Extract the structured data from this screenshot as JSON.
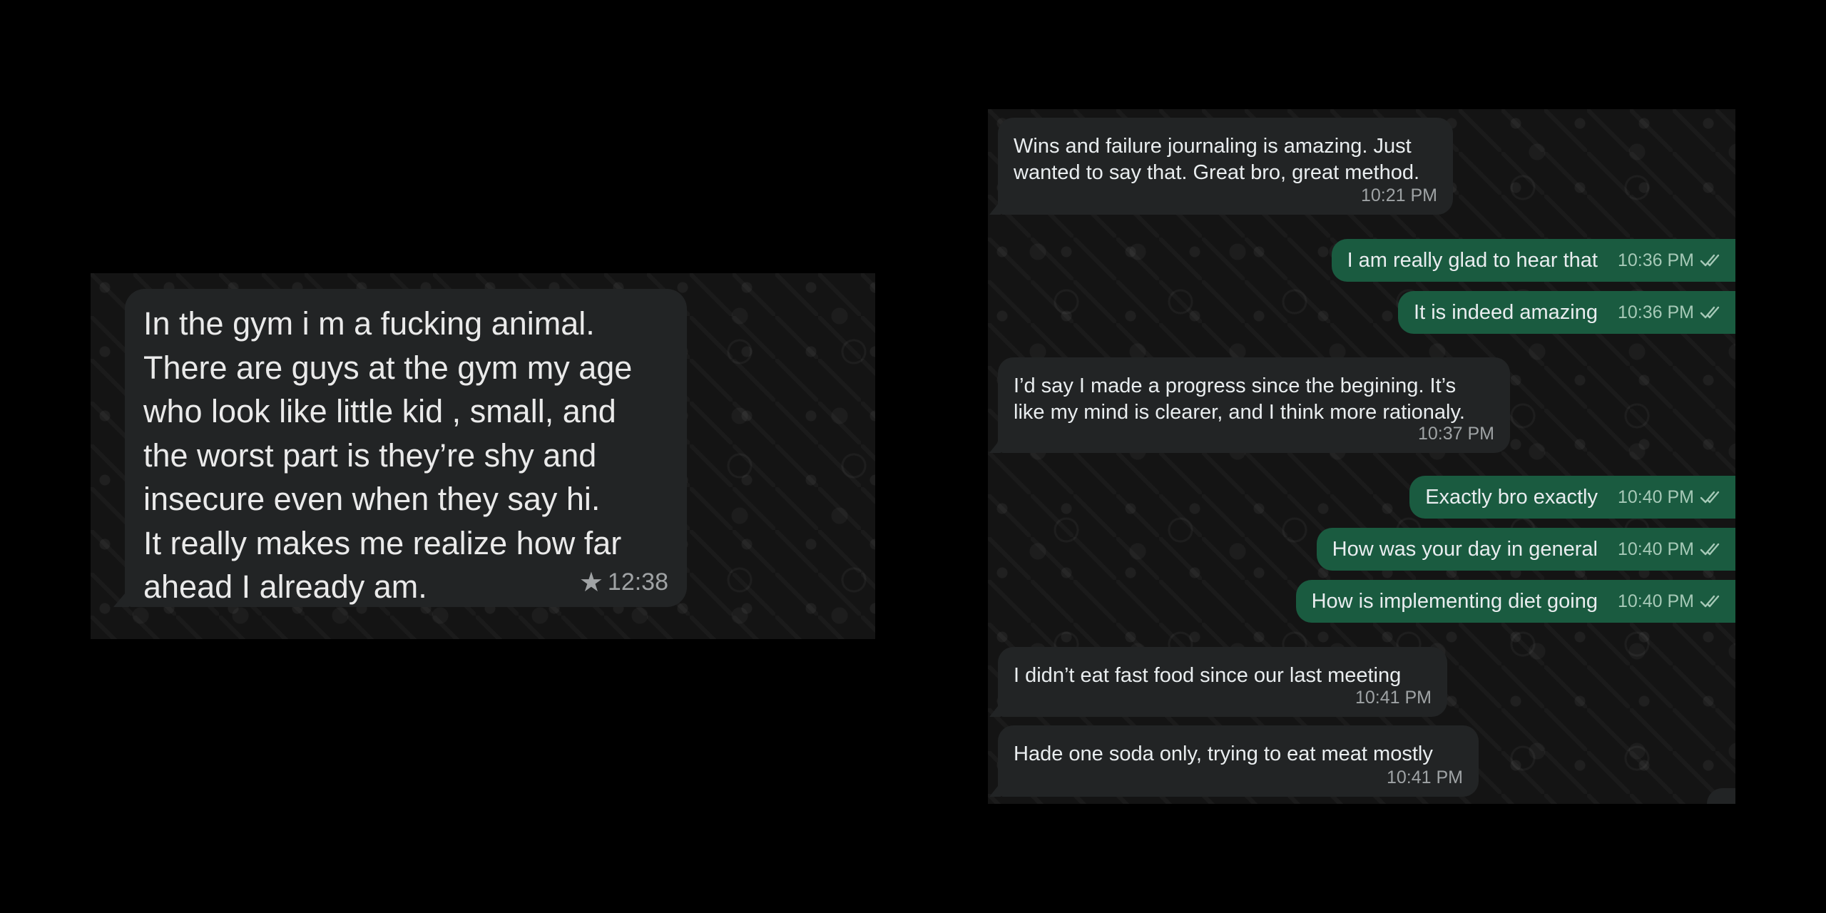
{
  "left_screenshot": {
    "message": {
      "lines": [
        "In the gym i m a fucking animal.",
        "There are guys at the gym my age",
        "who look like little kid , small, and",
        "the worst part is they’re shy and",
        "insecure even when they say hi.",
        "It really makes me realize how far",
        "ahead I already am."
      ],
      "time": "12:38",
      "starred_icon": "star-icon"
    }
  },
  "right_screenshot": {
    "messages": [
      {
        "direction": "incoming",
        "lines": [
          "Wins and failure journaling is amazing. Just",
          "wanted to say that. Great bro, great method."
        ],
        "time": "10:21 PM"
      },
      {
        "direction": "outgoing",
        "text": "I am really glad to hear that",
        "time": "10:36 PM",
        "status_icon": "double-check-icon"
      },
      {
        "direction": "outgoing",
        "text": "It is indeed amazing",
        "time": "10:36 PM",
        "status_icon": "double-check-icon"
      },
      {
        "direction": "incoming",
        "lines": [
          "I’d say I made a progress since the begining. It’s",
          "like my mind is clearer, and I think more rationaly."
        ],
        "time": "10:37 PM"
      },
      {
        "direction": "outgoing",
        "text": "Exactly bro exactly",
        "time": "10:40 PM",
        "status_icon": "double-check-icon"
      },
      {
        "direction": "outgoing",
        "text": "How was your day in general",
        "time": "10:40 PM",
        "status_icon": "double-check-icon"
      },
      {
        "direction": "outgoing",
        "text": "How is implementing diet going",
        "time": "10:40 PM",
        "status_icon": "double-check-icon"
      },
      {
        "direction": "incoming",
        "lines": [
          "I didn’t eat fast food since our last meeting"
        ],
        "time": "10:41 PM"
      },
      {
        "direction": "incoming",
        "lines": [
          "Hade one soda only, trying to eat meat mostly"
        ],
        "time": "10:41 PM"
      }
    ]
  },
  "colors": {
    "page_background": "#000000",
    "chat_background": "#141414",
    "incoming_bubble": "#222425",
    "outgoing_bubble": "#1a5b40",
    "text": "#e9edef",
    "meta_text": "#9fa3a5"
  }
}
